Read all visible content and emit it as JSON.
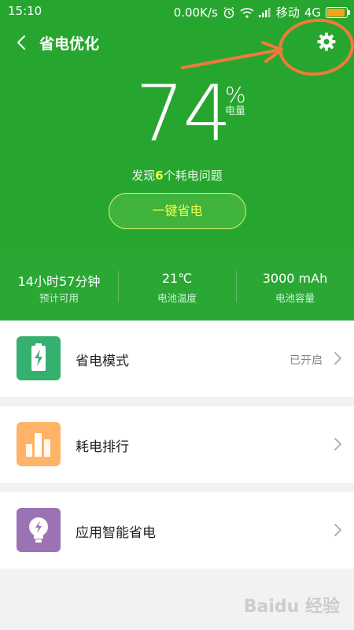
{
  "status_bar": {
    "time": "15:10",
    "net_speed": "0.00K/s",
    "carrier": "移动",
    "network": "4G"
  },
  "header": {
    "title": "省电优化"
  },
  "battery": {
    "level": "74",
    "percent_sign": "%",
    "label": "电量",
    "issues_prefix": "发现",
    "issues_count": "6",
    "issues_suffix": "个耗电问题",
    "optimize_label": "一键省电"
  },
  "stats": [
    {
      "value": "14小时57分钟",
      "label": "预计可用"
    },
    {
      "value": "21℃",
      "label": "电池温度"
    },
    {
      "value": "3000 mAh",
      "label": "电池容量"
    }
  ],
  "list": [
    {
      "label": "省电模式",
      "status": "已开启",
      "icon": "battery-charge-icon",
      "color": "#36b06f"
    },
    {
      "label": "耗电排行",
      "status": "",
      "icon": "bar-chart-icon",
      "color": "#ffb366"
    },
    {
      "label": "应用智能省电",
      "status": "",
      "icon": "lightbulb-icon",
      "color": "#9b73b3"
    }
  ],
  "colors": {
    "primary_green": "#27a62f",
    "highlight_yellow": "#f2ff4a",
    "annotation_orange": "#f07a3c"
  },
  "watermark": "Baidu 经验"
}
